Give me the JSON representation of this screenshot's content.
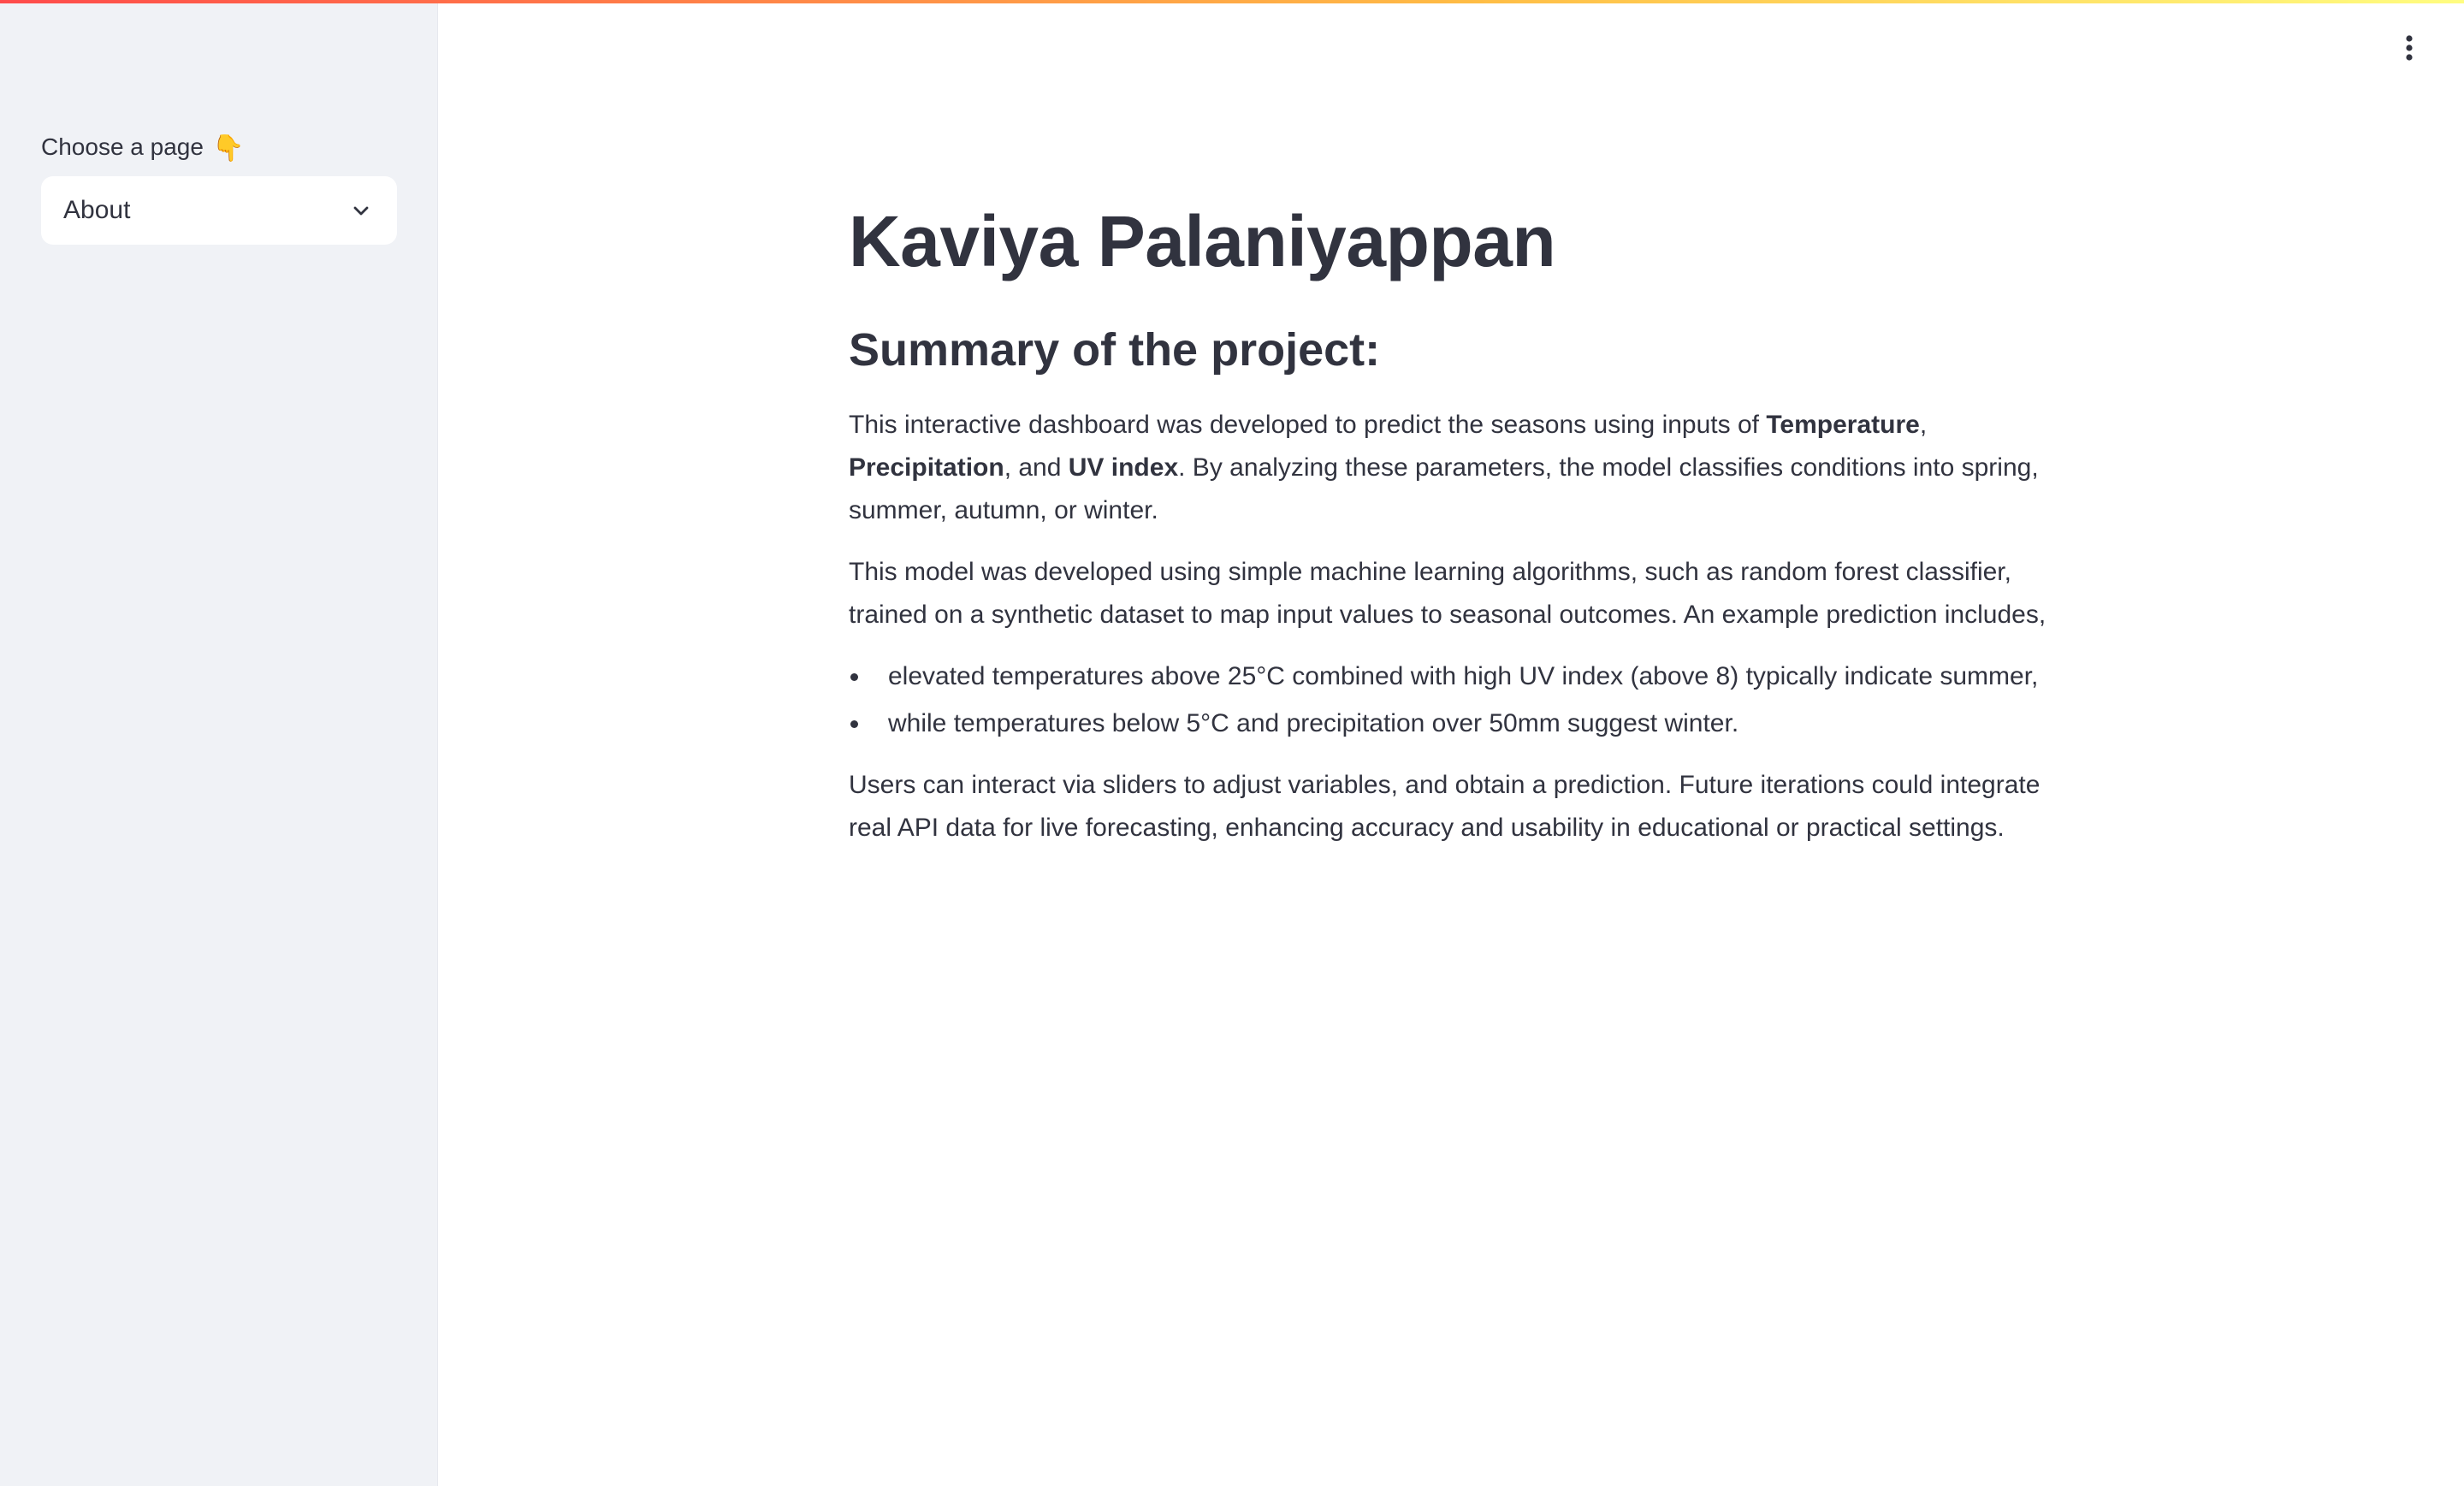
{
  "sidebar": {
    "select_label": "Choose a page",
    "select_label_emoji": "👇",
    "selected_page": "About"
  },
  "header": {
    "menu_icon": "more-vertical-icon"
  },
  "main": {
    "title": "Kaviya Palaniyappan",
    "section_heading": "Summary of the project:",
    "p1": {
      "text1": "This interactive dashboard was developed to predict the seasons using inputs of ",
      "bold1": "Temperature",
      "text2": ", ",
      "bold2": "Precipitation",
      "text3": ", and ",
      "bold3": "UV index",
      "text4": ". By analyzing these parameters, the model classifies conditions into spring, summer, autumn, or winter."
    },
    "p2": "This model was developed using simple machine learning algorithms, such as random forest classifier, trained on a synthetic dataset to map input values to seasonal outcomes. An example prediction includes,",
    "bullets": [
      "elevated temperatures above 25°C combined with high UV index (above 8) typically indicate summer,",
      "while temperatures below 5°C and precipitation over 50mm suggest winter."
    ],
    "p3": "Users can interact via sliders to adjust variables, and obtain a prediction. Future iterations could integrate real API data for live forecasting, enhancing accuracy and usability in educational or practical settings."
  },
  "colors": {
    "sidebar_bg": "#f0f2f6",
    "text": "#31333f",
    "decoration_start": "#ff4b4b",
    "decoration_end": "#fffd80"
  }
}
